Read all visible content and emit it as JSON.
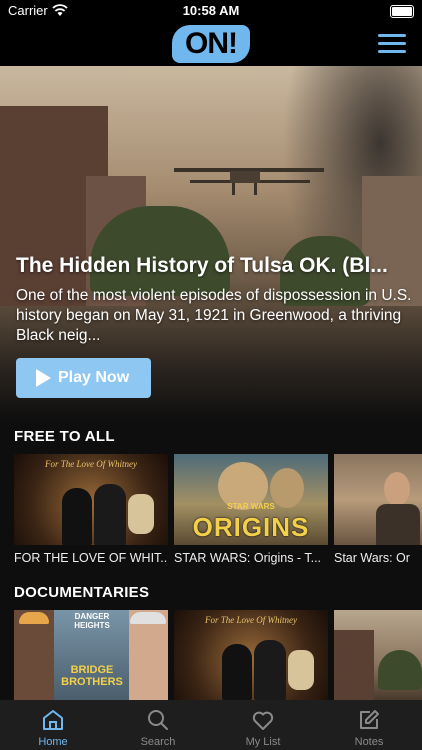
{
  "status_bar": {
    "carrier": "Carrier",
    "time": "10:58 AM"
  },
  "header": {
    "logo_text": "ON!",
    "accent_color": "#6fb7ec"
  },
  "hero": {
    "title": "The Hidden History of Tulsa OK. (Bl...",
    "description": "One of the most violent episodes of dispossession in U.S. history began on May 31, 1921 in Greenwood, a thriving Black neig...",
    "play_label": "Play Now"
  },
  "sections": [
    {
      "title": "FREE TO ALL",
      "items": [
        {
          "caption": "FOR THE LOVE OF WHIT..."
        },
        {
          "caption": "STAR WARS: Origins - T..."
        },
        {
          "caption": "Star Wars: Or"
        }
      ]
    },
    {
      "title": "DOCUMENTARIES",
      "items": [
        {
          "caption": ""
        },
        {
          "caption": ""
        },
        {
          "caption": ""
        }
      ]
    }
  ],
  "poster_text": {
    "whitney": "For The Love Of Whitney",
    "starwars_top": "STAR WARS",
    "starwars_main": "ORIGINS",
    "bridge": "BRIDGE BROTHERS",
    "danger": "DANGER HEIGHTS"
  },
  "tabs": [
    {
      "label": "Home",
      "icon": "home-icon",
      "active": true
    },
    {
      "label": "Search",
      "icon": "search-icon",
      "active": false
    },
    {
      "label": "My List",
      "icon": "heart-icon",
      "active": false
    },
    {
      "label": "Notes",
      "icon": "notes-icon",
      "active": false
    }
  ]
}
